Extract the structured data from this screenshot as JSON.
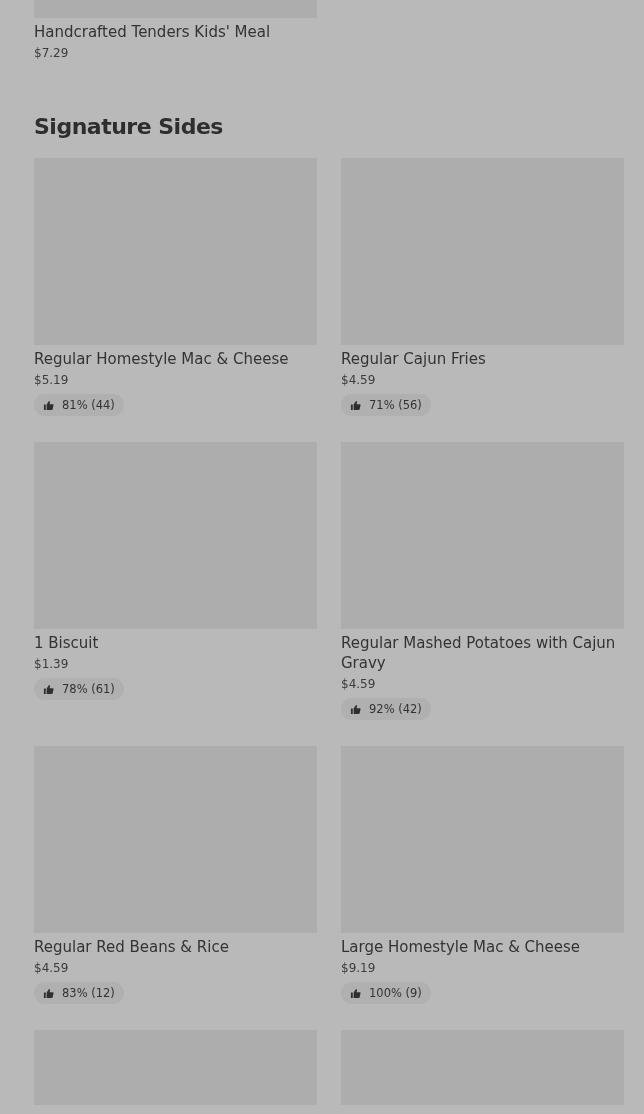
{
  "previous_item": {
    "kind": "picture",
    "name": "Handcrafted Tenders Kids' Meal",
    "price": "$7.29"
  },
  "section": {
    "title": "Signature Sides",
    "items": [
      {
        "kind": "picture",
        "name": "Regular Homestyle Mac & Cheese",
        "price": "$5.19",
        "rating": "81% (44)"
      },
      {
        "kind": "picture",
        "name": "Regular Cajun Fries",
        "price": "$4.59",
        "rating": "71% (56)"
      },
      {
        "kind": "picture",
        "name": "1 Biscuit",
        "price": "$1.39",
        "rating": "78% (61)"
      },
      {
        "kind": "picture",
        "name": "Regular Mashed Potatoes with Cajun Gravy",
        "price": "$4.59",
        "rating": "92% (42)"
      },
      {
        "kind": "picture",
        "name": "Regular Red Beans & Rice",
        "price": "$4.59",
        "rating": "83% (12)"
      },
      {
        "kind": "picture",
        "name": "Large Homestyle Mac & Cheese",
        "price": "$9.19",
        "rating": "100% (9)"
      },
      {
        "kind": "picture"
      },
      {
        "kind": "picture"
      }
    ]
  }
}
